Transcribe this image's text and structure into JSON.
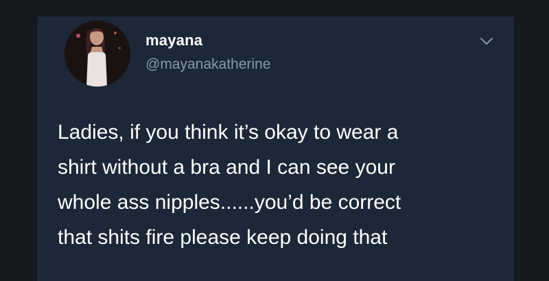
{
  "tweet": {
    "author": {
      "display_name": "mayana",
      "handle": "@mayanakatherine",
      "avatar_icon": "profile-photo"
    },
    "menu_icon": "chevron-down-icon",
    "text_lines": [
      "Ladies, if you think it’s okay to wear a",
      "shirt without a bra and I can see your",
      "whole ass nipples......you’d be correct",
      "that shits fire please keep doing that"
    ]
  },
  "colors": {
    "background": "#15181d",
    "card": "#1c2838",
    "text": "#ffffff",
    "secondary_text": "#8899a6"
  }
}
